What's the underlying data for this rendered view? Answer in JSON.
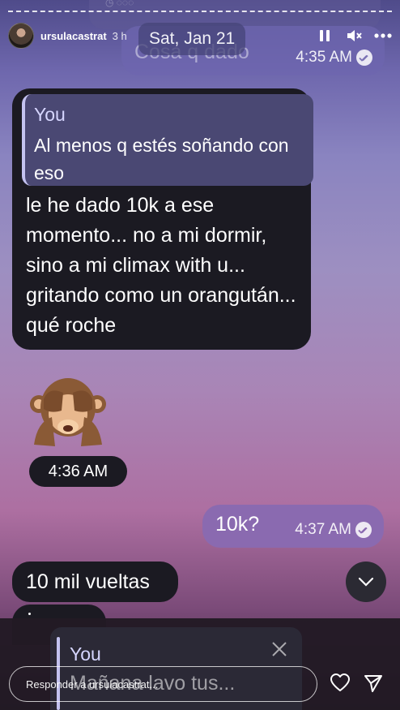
{
  "story": {
    "username": "ursulacastrat",
    "time_ago": "3 h",
    "pause_icon": "pause-icon",
    "mute_icon": "speaker-muted-icon",
    "more_icon": "more-horizontal-icon"
  },
  "chat": {
    "top_fragment_text": "con eso",
    "date_badge": "Sat, Jan 21",
    "top_outgoing": {
      "text": "Cosa q dado",
      "time": "4:35 AM"
    },
    "incoming_main": {
      "reply_author": "You",
      "reply_text": "Al menos q estés soñando con eso",
      "text": "le he dado 10k a ese momento... no a mi dormir, sino a mi climax with u... gritando como un orangután... qué roche"
    },
    "emoji": "see-no-evil-monkey",
    "emoji_time": "4:36 AM",
    "outgoing_10k": {
      "text": "10k?",
      "time": "4:37 AM"
    },
    "incoming_small": "10 mil vueltas",
    "compose": {
      "reply_author": "You",
      "reply_text": "Mañana lavo tus..."
    }
  },
  "footer": {
    "reply_placeholder": "Responder a ursulacastrat...",
    "heart_icon": "heart-icon",
    "send_icon": "send-icon"
  },
  "colors": {
    "bubble_incoming": "#1b1a22",
    "bubble_outgoing": "#8a6ab0",
    "reply_accent": "#c3c2f0"
  }
}
